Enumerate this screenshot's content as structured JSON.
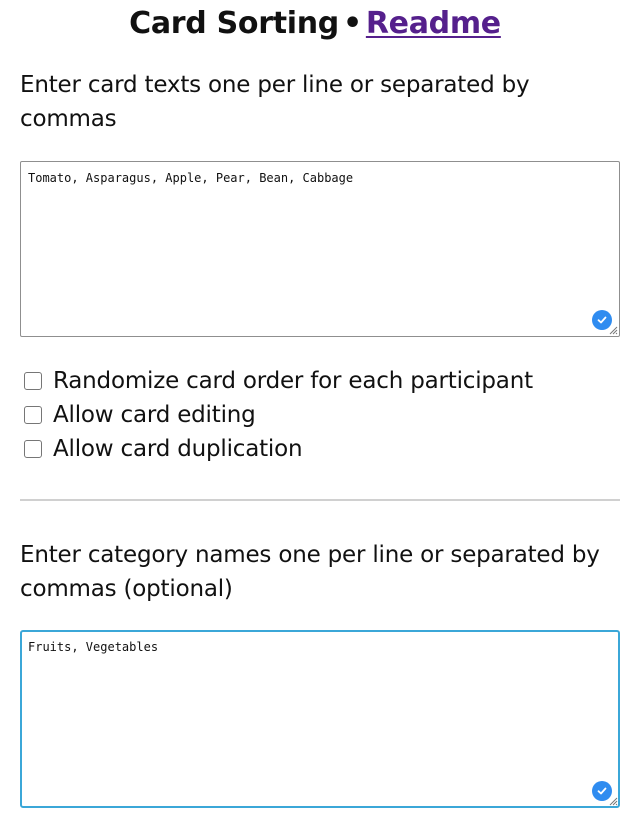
{
  "header": {
    "title": "Card Sorting",
    "separator": "•",
    "readme_link": "Readme",
    "link_color": "#55208c"
  },
  "cards": {
    "prompt": "Enter card texts one per line or separated by commas",
    "value": "Tomato, Asparagus, Apple, Pear, Bean, Cabbage"
  },
  "options": [
    {
      "label": "Randomize card order for each participant",
      "checked": false
    },
    {
      "label": "Allow card editing",
      "checked": false
    },
    {
      "label": "Allow card duplication",
      "checked": false
    }
  ],
  "categories": {
    "prompt": "Enter category names one per line or separated by commas (optional)",
    "value": "Fruits, Vegetables",
    "focused": true
  },
  "colors": {
    "focus_border": "#3ba7d8",
    "badge": "#2f8cf0"
  },
  "icons": {
    "textarea_badge": "checkmark-circle-icon",
    "resize": "resize-grip-icon"
  }
}
